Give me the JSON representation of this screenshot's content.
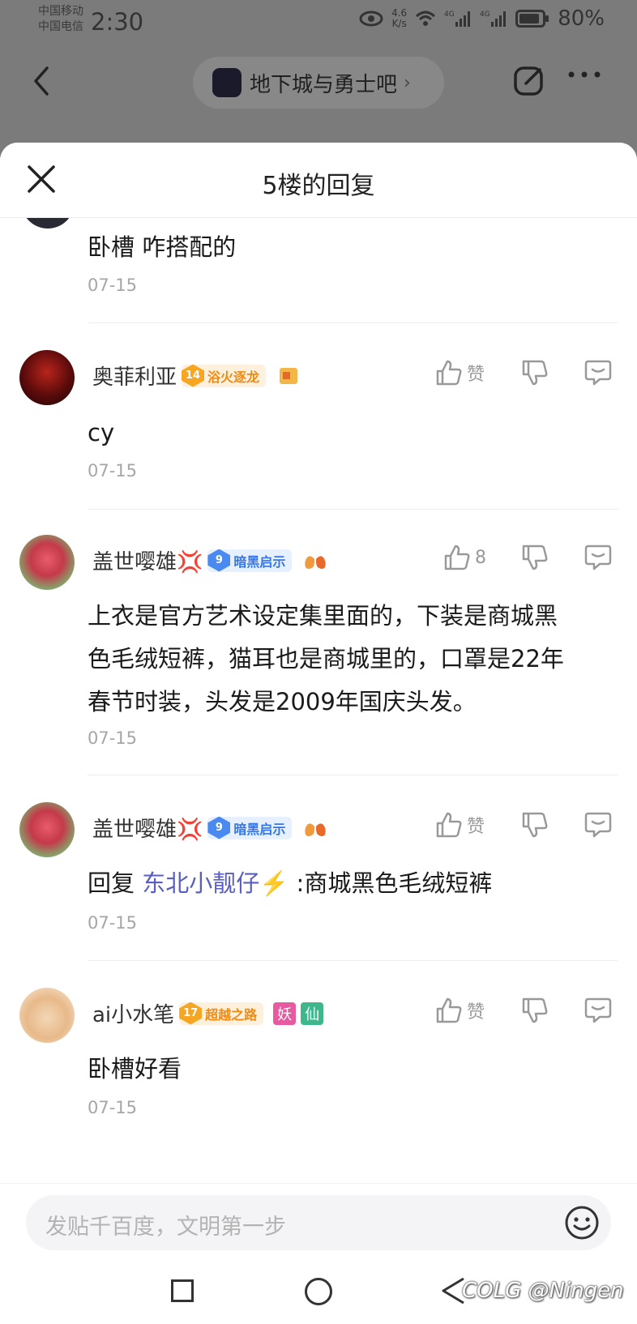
{
  "status_bar": {
    "carrier_1": "中国移动",
    "carrier_2": "中国电信",
    "time": "2:30",
    "net_speed_value": "4.6",
    "net_speed_unit": "K/s",
    "battery": "80%"
  },
  "nav": {
    "forum_name": "地下城与勇士吧",
    "chevron": "›"
  },
  "sheet": {
    "title": "5楼的回复"
  },
  "replies": [
    {
      "content": "卧槽 咋搭配的",
      "date": "07-15"
    },
    {
      "username": "奥菲利亚",
      "level": "14",
      "badge_title": "浴火逐龙",
      "like_label": "赞",
      "content": "cy",
      "date": "07-15"
    },
    {
      "username": "盖世嘤雄💢",
      "level": "9",
      "badge_title": "暗黑启示",
      "like_count": "8",
      "content_lines": [
        "上衣是官方艺术设定集里面的，下装是商城黑",
        "色毛绒短裤，猫耳也是商城里的，口罩是22年",
        "春节时装，头发是2009年国庆头发。"
      ],
      "date": "07-15"
    },
    {
      "username": "盖世嘤雄💢",
      "level": "9",
      "badge_title": "暗黑启示",
      "like_label": "赞",
      "reply_prefix": "回复 ",
      "mention": "东北小靓仔⚡️",
      "content": " :商城黑色毛绒短裤",
      "date": "07-15"
    },
    {
      "username": "ai小水笔",
      "level": "17",
      "badge_title": "超越之路",
      "tag_1": "妖",
      "tag_2": "仙",
      "like_label": "赞",
      "content": "卧槽好看",
      "date": "07-15"
    }
  ],
  "input": {
    "placeholder": "发贴千百度，文明第一步"
  },
  "watermark": "COLG @Ningen",
  "colors": {
    "overlay": "#7b7b7b",
    "mention": "#5a5fbf",
    "badge_gold": "#f7a623",
    "badge_blue": "#4a8af0",
    "tag_pink": "#e85aa0",
    "tag_green": "#3fb68b"
  },
  "icons": [
    "back-icon",
    "forum-logo-icon",
    "share-icon",
    "more-icon",
    "close-icon",
    "like-icon",
    "dislike-icon",
    "reply-icon",
    "emoji-icon",
    "recent-apps-icon",
    "home-icon",
    "system-back-icon"
  ]
}
